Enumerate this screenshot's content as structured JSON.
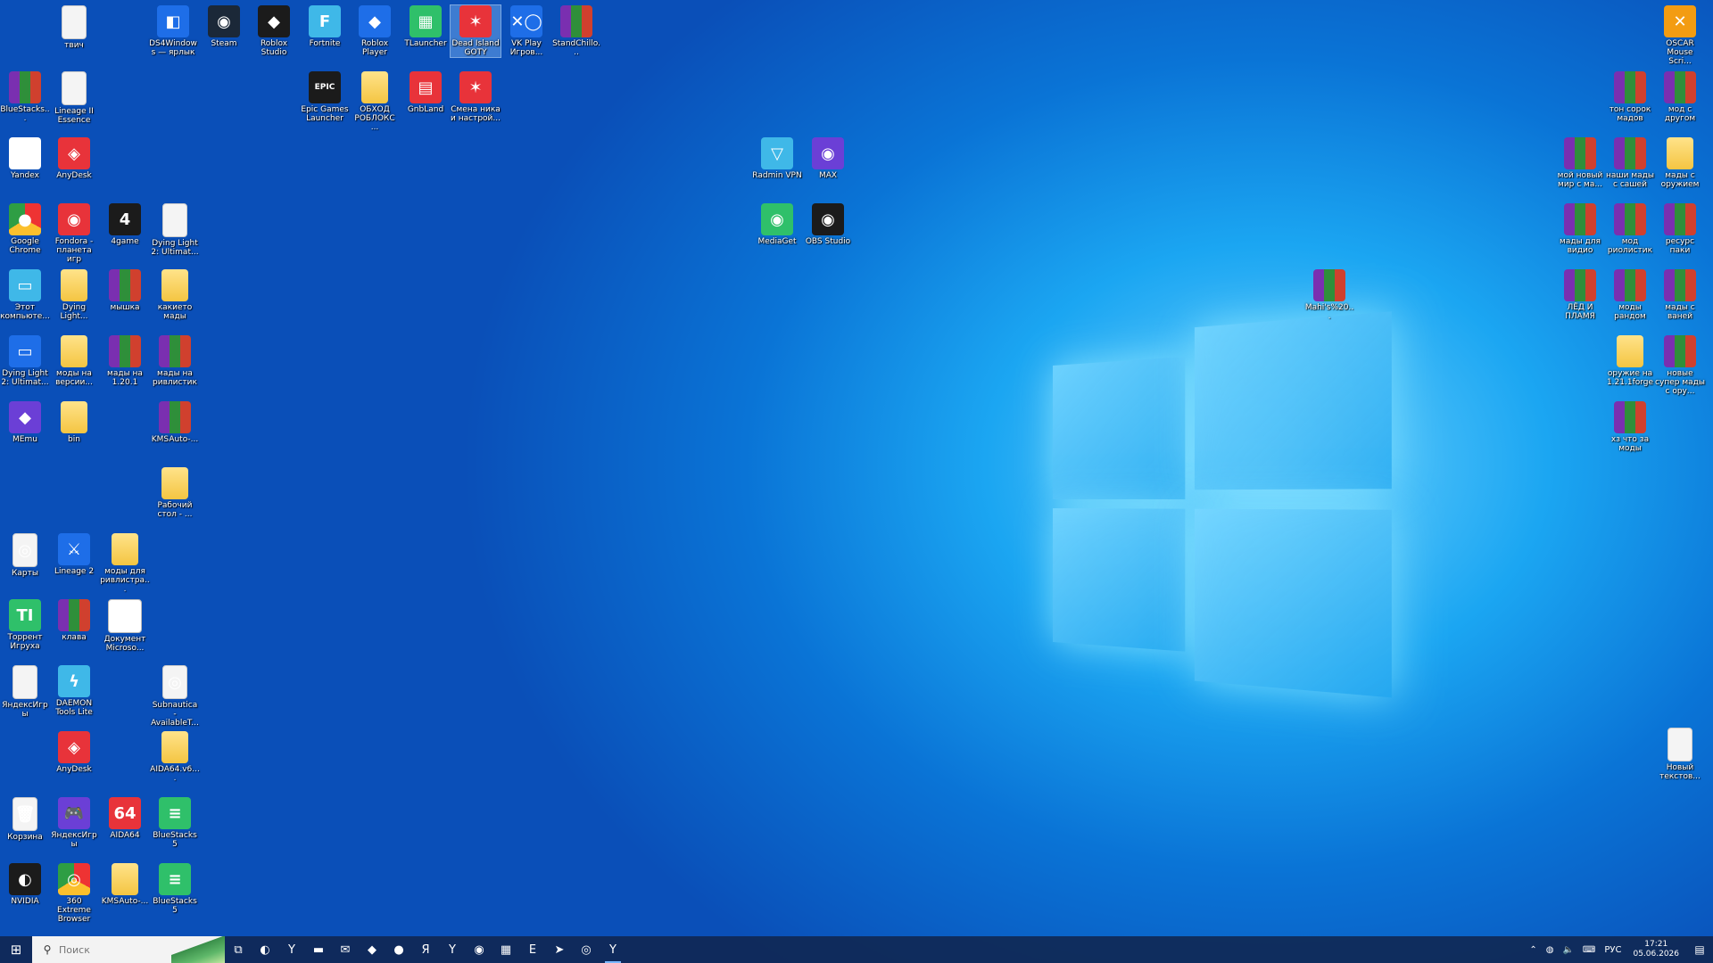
{
  "desktop": {
    "icons": [
      {
        "label": "твич",
        "type": "file",
        "glyph": ""
      },
      {
        "label": "DS4Windows — ярлык",
        "type": "blue",
        "glyph": "◧"
      },
      {
        "label": "Steam",
        "type": "steam",
        "glyph": "◉"
      },
      {
        "label": "Roblox Studio",
        "type": "dark",
        "glyph": "◆"
      },
      {
        "label": "Fortnite",
        "type": "cyan",
        "glyph": "F"
      },
      {
        "label": "Roblox Player",
        "type": "blue",
        "glyph": "◆"
      },
      {
        "label": "TLauncher",
        "type": "green",
        "glyph": "▦"
      },
      {
        "label": "Dead Island GOTY",
        "type": "red",
        "glyph": "✶"
      },
      {
        "label": "VK Play Игров...",
        "type": "blue",
        "glyph": "✕◯"
      },
      {
        "label": "StandChillo...",
        "type": "rar",
        "glyph": ""
      },
      {
        "label": "BlueStacks...",
        "type": "rar",
        "glyph": ""
      },
      {
        "label": "Lineage II Essence",
        "type": "file",
        "glyph": ""
      },
      {
        "label": "Epic Games Launcher",
        "type": "dark",
        "glyph": "EPIC"
      },
      {
        "label": "ОБХОД РОБЛОКС ...",
        "type": "folder",
        "glyph": ""
      },
      {
        "label": "GnbLand",
        "type": "red",
        "glyph": "▤"
      },
      {
        "label": "Смена ника и настрой...",
        "type": "red",
        "glyph": "✶"
      },
      {
        "label": "Yandex",
        "type": "y",
        "glyph": "Y"
      },
      {
        "label": "AnyDesk",
        "type": "red",
        "glyph": "◈"
      },
      {
        "label": "Google Chrome",
        "type": "chrome",
        "glyph": "●"
      },
      {
        "label": "Fondora - планета игр",
        "type": "red",
        "glyph": "◉"
      },
      {
        "label": "4game",
        "type": "dark",
        "glyph": "4"
      },
      {
        "label": "Dying Light 2: Ultimat...",
        "type": "file",
        "glyph": ""
      },
      {
        "label": "Этот компьюте...",
        "type": "cyan",
        "glyph": "▭"
      },
      {
        "label": "Dying Light...",
        "type": "folder",
        "glyph": ""
      },
      {
        "label": "мышка",
        "type": "rar",
        "glyph": ""
      },
      {
        "label": "какието мады",
        "type": "folder",
        "glyph": ""
      },
      {
        "label": "Dying Light 2: Ultimat...",
        "type": "blue",
        "glyph": "▭"
      },
      {
        "label": "моды на версии...",
        "type": "folder",
        "glyph": ""
      },
      {
        "label": "мады на 1.20.1",
        "type": "rar",
        "glyph": ""
      },
      {
        "label": "мады на ривлистик",
        "type": "rar",
        "glyph": ""
      },
      {
        "label": "MEmu",
        "type": "purple",
        "glyph": "◆"
      },
      {
        "label": "bin",
        "type": "folder",
        "glyph": ""
      },
      {
        "label": "KMSAuto-...",
        "type": "rar",
        "glyph": ""
      },
      {
        "label": "Рабочий стол - ...",
        "type": "folder",
        "glyph": ""
      },
      {
        "label": "Карты",
        "type": "file",
        "glyph": "◎"
      },
      {
        "label": "Lineage 2",
        "type": "blue",
        "glyph": "⚔"
      },
      {
        "label": "моды для ривлистра...",
        "type": "folder",
        "glyph": ""
      },
      {
        "label": "Торрент Игруха",
        "type": "green",
        "glyph": "TI"
      },
      {
        "label": "клава",
        "type": "rar",
        "glyph": ""
      },
      {
        "label": "Документ Microso...",
        "type": "word",
        "glyph": "W"
      },
      {
        "label": "ЯндексИгры",
        "type": "file",
        "glyph": ""
      },
      {
        "label": "DAEMON Tools Lite",
        "type": "cyan",
        "glyph": "ϟ"
      },
      {
        "label": "Subnautica - AvailableT...",
        "type": "file",
        "glyph": "◎"
      },
      {
        "label": "AnyDesk",
        "type": "red",
        "glyph": "◈"
      },
      {
        "label": "AIDA64.v6....",
        "type": "folder",
        "glyph": ""
      },
      {
        "label": "Корзина",
        "type": "file",
        "glyph": "🗑"
      },
      {
        "label": "ЯндексИгры",
        "type": "purple",
        "glyph": "🎮"
      },
      {
        "label": "AIDA64",
        "type": "red",
        "glyph": "64"
      },
      {
        "label": "BlueStacks 5",
        "type": "green",
        "glyph": "≡"
      },
      {
        "label": "NVIDIA",
        "type": "dark",
        "glyph": "◐"
      },
      {
        "label": "360 Extreme Browser",
        "type": "chrome",
        "glyph": "◎"
      },
      {
        "label": "KMSAuto-...",
        "type": "folder",
        "glyph": ""
      },
      {
        "label": "BlueStacks 5",
        "type": "green",
        "glyph": "≡"
      },
      {
        "label": "Radmin VPN",
        "type": "cyan",
        "glyph": "▽"
      },
      {
        "label": "MAX",
        "type": "purple",
        "glyph": "◉"
      },
      {
        "label": "MediaGet",
        "type": "green",
        "glyph": "◉"
      },
      {
        "label": "OBS Studio",
        "type": "dark",
        "glyph": "◉"
      },
      {
        "label": "Mahi's%20...",
        "type": "rar",
        "glyph": ""
      },
      {
        "label": "OSCAR Mouse Scri...",
        "type": "orange",
        "glyph": "✕"
      },
      {
        "label": "тон сорок мадов",
        "type": "rar",
        "glyph": ""
      },
      {
        "label": "мод с другом",
        "type": "rar",
        "glyph": ""
      },
      {
        "label": "мой новый мир с ма...",
        "type": "rar",
        "glyph": ""
      },
      {
        "label": "наши мады с сашей",
        "type": "rar",
        "glyph": ""
      },
      {
        "label": "мады с оружием",
        "type": "folder",
        "glyph": ""
      },
      {
        "label": "мады для видио",
        "type": "rar",
        "glyph": ""
      },
      {
        "label": "мод риолистик",
        "type": "rar",
        "glyph": ""
      },
      {
        "label": "ресурс паки",
        "type": "rar",
        "glyph": ""
      },
      {
        "label": "ЛЁД И ПЛАМЯ",
        "type": "rar",
        "glyph": ""
      },
      {
        "label": "моды рандом",
        "type": "rar",
        "glyph": ""
      },
      {
        "label": "мады с ваней",
        "type": "rar",
        "glyph": ""
      },
      {
        "label": "оружие на 1.21.1forge",
        "type": "folder",
        "glyph": ""
      },
      {
        "label": "новые супер мады с ору...",
        "type": "rar",
        "glyph": ""
      },
      {
        "label": "хз что за моды",
        "type": "rar",
        "glyph": ""
      },
      {
        "label": "Новый текстов...",
        "type": "file",
        "glyph": ""
      }
    ]
  },
  "taskbar": {
    "search_placeholder": "Поиск",
    "apps": [
      {
        "icon": "task-view-icon",
        "glyph": "⧉"
      },
      {
        "icon": "edge-icon",
        "glyph": "◐"
      },
      {
        "icon": "yandex-browser-icon",
        "glyph": "Y"
      },
      {
        "icon": "file-explorer-icon",
        "glyph": "▬"
      },
      {
        "icon": "mail-icon",
        "glyph": "✉"
      },
      {
        "icon": "roblox-icon",
        "glyph": "◆"
      },
      {
        "icon": "app-red-icon",
        "glyph": "●"
      },
      {
        "icon": "yandex-icon",
        "glyph": "Я"
      },
      {
        "icon": "yandex-music-icon",
        "glyph": "Y"
      },
      {
        "icon": "gamepad-icon",
        "glyph": "◉"
      },
      {
        "icon": "minecraft-icon",
        "glyph": "▦"
      },
      {
        "icon": "epic-games-icon",
        "glyph": "E"
      },
      {
        "icon": "telegram-icon",
        "glyph": "➤"
      },
      {
        "icon": "chrome-icon",
        "glyph": "◎"
      },
      {
        "icon": "yandex-browser-active-icon",
        "glyph": "Y"
      }
    ],
    "tray": {
      "language": "РУС",
      "time": "17:21",
      "date": "05.06.2026"
    }
  }
}
